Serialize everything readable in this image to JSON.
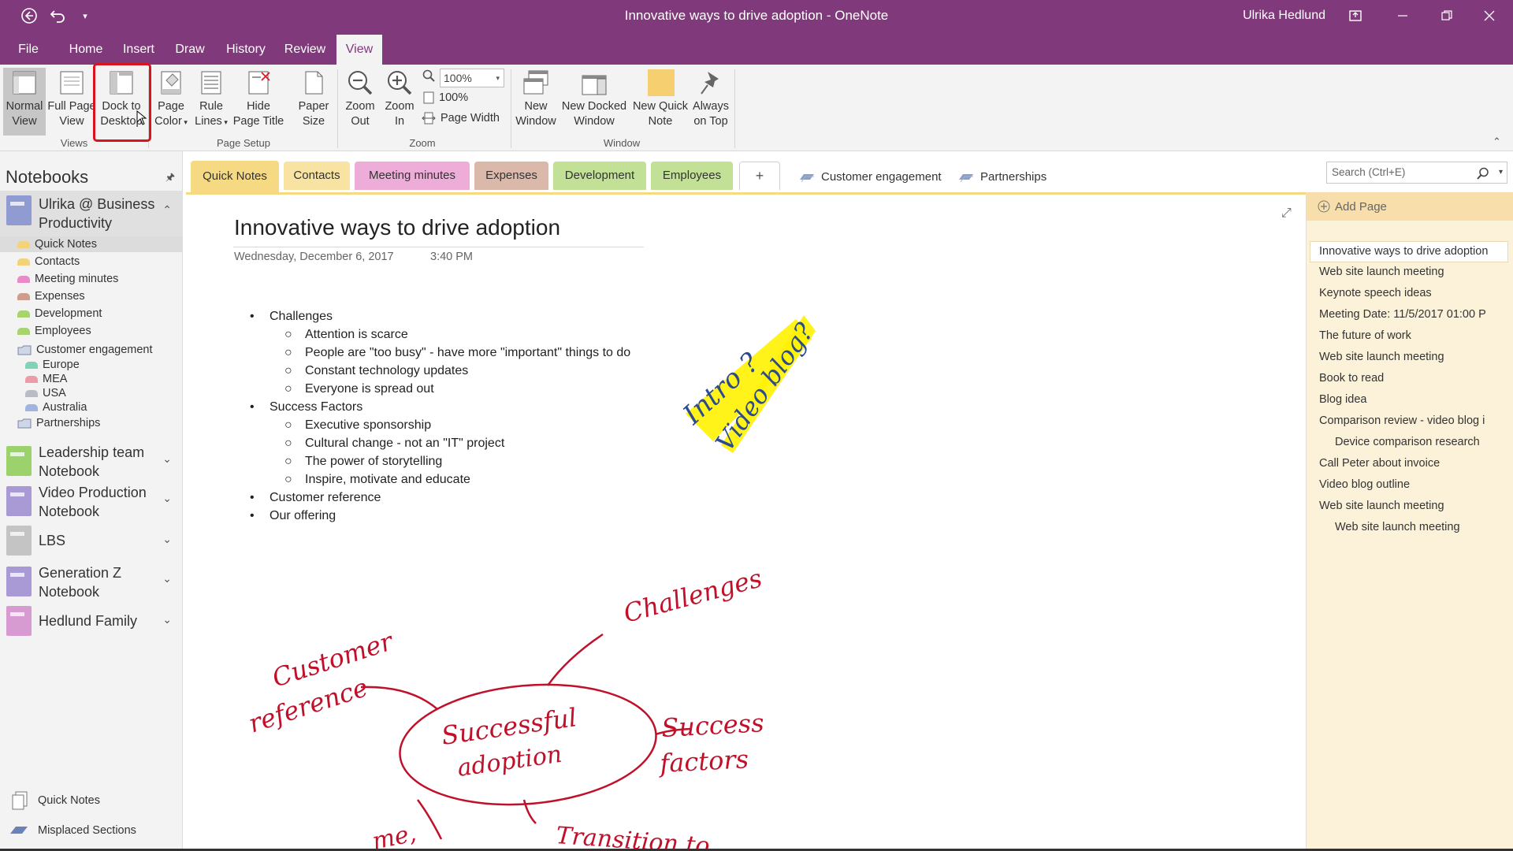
{
  "window": {
    "title": "Innovative ways to drive adoption  -  OneNote",
    "user": "Ulrika Hedlund",
    "accent": "#80397b"
  },
  "titlebar_icons": [
    "back-icon",
    "undo-icon",
    "quick-access-dropdown-icon",
    "ribbon-display-options-icon",
    "minimize-icon",
    "restore-icon",
    "close-icon"
  ],
  "menu": {
    "tabs": [
      "File",
      "Home",
      "Insert",
      "Draw",
      "History",
      "Review",
      "View"
    ],
    "active": "View"
  },
  "ribbon": {
    "views": {
      "label": "Views",
      "normal_view": [
        "Normal",
        "View"
      ],
      "full_page_view": [
        "Full Page",
        "View"
      ],
      "dock_to_desktop": [
        "Dock to",
        "Desktop"
      ]
    },
    "page_setup": {
      "label": "Page Setup",
      "page_color": [
        "Page",
        "Color"
      ],
      "rule_lines": [
        "Rule",
        "Lines"
      ],
      "hide_page_title": [
        "Hide",
        "Page Title"
      ],
      "paper_size": [
        "Paper",
        "Size"
      ]
    },
    "zoom": {
      "label": "Zoom",
      "zoom_out": [
        "Zoom",
        "Out"
      ],
      "zoom_in": [
        "Zoom",
        "In"
      ],
      "zoom_value": "100%",
      "hundred_percent": "100%",
      "page_width": "Page Width"
    },
    "window": {
      "label": "Window",
      "new_window": [
        "New",
        "Window"
      ],
      "new_docked_window": [
        "New Docked",
        "Window"
      ],
      "new_quick_note": [
        "New Quick",
        "Note"
      ],
      "always_on_top": [
        "Always",
        "on Top"
      ]
    }
  },
  "notebooks": {
    "heading": "Notebooks",
    "current": {
      "name": [
        "Ulrika @ Business",
        "Productivity"
      ],
      "color": "#8f9bd1",
      "sections": [
        {
          "name": "Quick Notes",
          "color": "#f2d37a"
        },
        {
          "name": "Contacts",
          "color": "#f2d37a"
        },
        {
          "name": "Meeting minutes",
          "color": "#e98bc8"
        },
        {
          "name": "Expenses",
          "color": "#cc9c8c"
        },
        {
          "name": "Development",
          "color": "#a9d36e"
        },
        {
          "name": "Employees",
          "color": "#a9d36e"
        }
      ],
      "group": {
        "name": "Customer engagement",
        "sections": [
          {
            "name": "Europe",
            "color": "#7ed3b8"
          },
          {
            "name": "MEA",
            "color": "#ee9ba8"
          },
          {
            "name": "USA",
            "color": "#b9bcc6"
          },
          {
            "name": "Australia",
            "color": "#9fb5e0"
          }
        ]
      },
      "group2": "Partnerships"
    },
    "others": [
      {
        "name": [
          "Leadership team",
          "Notebook"
        ],
        "color": "#9bd26b"
      },
      {
        "name": [
          "Video Production",
          "Notebook"
        ],
        "color": "#a99ad6"
      },
      {
        "name": [
          "LBS"
        ],
        "color": "#c4c4c4"
      },
      {
        "name": [
          "Generation Z",
          "Notebook"
        ],
        "color": "#a99ad6"
      },
      {
        "name": [
          "Hedlund Family"
        ],
        "color": "#d79ad1"
      }
    ],
    "footer": {
      "quick_notes": "Quick Notes",
      "misplaced": "Misplaced Sections"
    }
  },
  "section_tabs": {
    "tabs": [
      {
        "name": "Quick Notes",
        "color": "#f6d983"
      },
      {
        "name": "Contacts",
        "color": "#f8e3a3"
      },
      {
        "name": "Meeting minutes",
        "color": "#eeadd8"
      },
      {
        "name": "Expenses",
        "color": "#dab8aa"
      },
      {
        "name": "Development",
        "color": "#c3e196"
      },
      {
        "name": "Employees",
        "color": "#c3e196"
      }
    ],
    "add": "+",
    "groups": [
      "Customer engagement",
      "Partnerships"
    ],
    "search_placeholder": "Search (Ctrl+E)"
  },
  "page": {
    "title": "Innovative ways to drive adoption",
    "date": "Wednesday, December 6, 2017",
    "time": "3:40 PM",
    "outline": [
      {
        "text": "Challenges",
        "children": [
          "Attention is scarce",
          "People are \"too busy\" - have more \"important\" things to do",
          "Constant technology updates",
          "Everyone is spread out"
        ]
      },
      {
        "text": "Success Factors",
        "children": [
          "Executive sponsorship",
          "Cultural change - not an \"IT\" project",
          "The power of storytelling",
          "Inspire, motivate and educate"
        ]
      },
      {
        "text": "Customer reference",
        "children": []
      },
      {
        "text": "Our offering",
        "children": []
      }
    ],
    "ink": {
      "sticky": [
        "Intro ?",
        "Video blog?"
      ],
      "map_center": [
        "Successful",
        "adoption"
      ],
      "branches": [
        "Challenges",
        "Customer",
        "reference",
        "Success",
        "factors",
        "Transition to",
        "me,"
      ],
      "ink_color": "#c0102a",
      "blue_ink": "#2b4a8f",
      "highlighter": "#fff200"
    }
  },
  "pages": {
    "add_page": "Add Page",
    "list": [
      {
        "title": "Innovative ways to drive adoption",
        "level": 0,
        "active": true
      },
      {
        "title": "Web site launch meeting",
        "level": 0
      },
      {
        "title": "Keynote speech ideas",
        "level": 0
      },
      {
        "title": "Meeting Date: 11/5/2017 01:00 P",
        "level": 0
      },
      {
        "title": "The future of work",
        "level": 0
      },
      {
        "title": "Web site launch meeting",
        "level": 0
      },
      {
        "title": "Book to read",
        "level": 0
      },
      {
        "title": "Blog idea",
        "level": 0
      },
      {
        "title": "Comparison review - video blog i",
        "level": 0
      },
      {
        "title": "Device comparison research",
        "level": 1
      },
      {
        "title": "Call Peter about invoice",
        "level": 0
      },
      {
        "title": "Video blog outline",
        "level": 0
      },
      {
        "title": "Web site launch meeting",
        "level": 0
      },
      {
        "title": "Web site launch meeting",
        "level": 1
      }
    ]
  }
}
